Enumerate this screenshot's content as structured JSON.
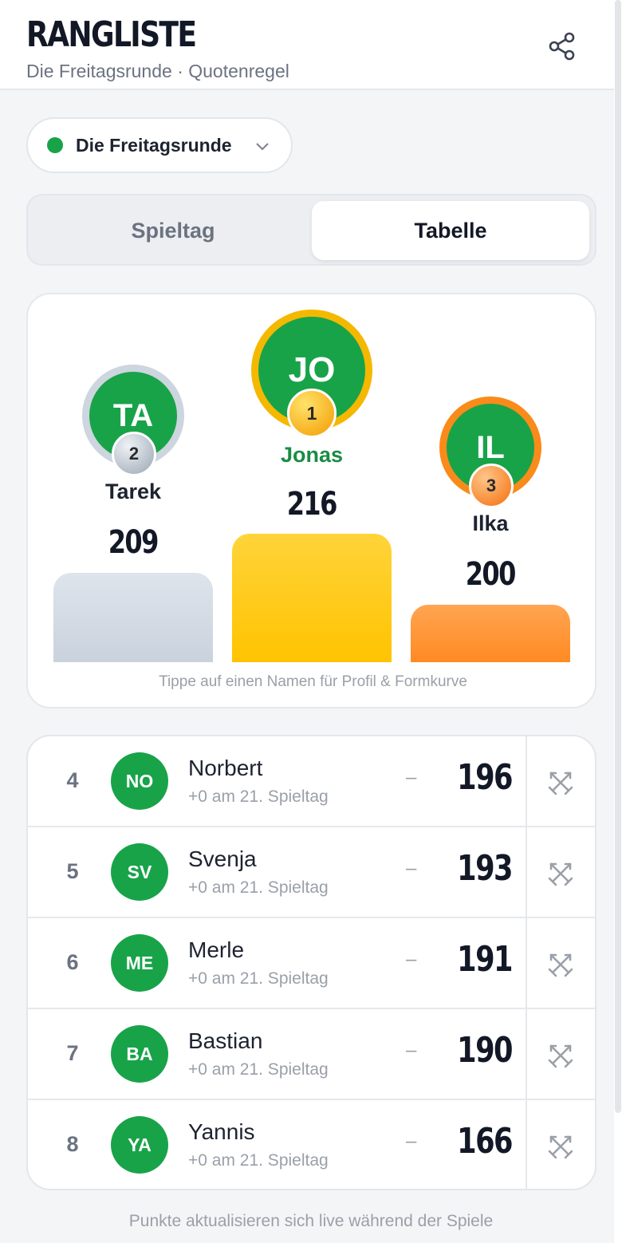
{
  "header": {
    "title": "RANGLISTE",
    "subtitle": "Die Freitagsrunde · Quotenregel",
    "share_icon": "share-icon"
  },
  "league_select": {
    "value": "Die Freitagsrunde",
    "status_color": "#18a349",
    "icon": "chevron-down-icon"
  },
  "tabs": [
    {
      "label": "Spieltag",
      "active": false
    },
    {
      "label": "Tabelle",
      "active": true
    }
  ],
  "podium": {
    "first": {
      "initials": "JO",
      "name": "Jonas",
      "rank": "1",
      "points": "216",
      "ring_color": "#f5b800"
    },
    "second": {
      "initials": "TA",
      "name": "Tarek",
      "rank": "2",
      "points": "209",
      "ring_color": "#cdd5df"
    },
    "third": {
      "initials": "IL",
      "name": "Ilka",
      "rank": "3",
      "points": "200",
      "ring_color": "#f98b1a"
    },
    "hint": "Tippe auf einen Namen für Profil & Formkurve"
  },
  "standings": [
    {
      "rank": "4",
      "initials": "NO",
      "name": "Norbert",
      "sub": "+0 am 21. Spieltag",
      "trend": "–",
      "points": "196",
      "action_icon": "swords-icon"
    },
    {
      "rank": "5",
      "initials": "SV",
      "name": "Svenja",
      "sub": "+0 am 21. Spieltag",
      "trend": "–",
      "points": "193",
      "action_icon": "swords-icon"
    },
    {
      "rank": "6",
      "initials": "ME",
      "name": "Merle",
      "sub": "+0 am 21. Spieltag",
      "trend": "–",
      "points": "191",
      "action_icon": "swords-icon"
    },
    {
      "rank": "7",
      "initials": "BA",
      "name": "Bastian",
      "sub": "+0 am 21. Spieltag",
      "trend": "–",
      "points": "190",
      "action_icon": "swords-icon"
    },
    {
      "rank": "8",
      "initials": "YA",
      "name": "Yannis",
      "sub": "+0 am 21. Spieltag",
      "trend": "–",
      "points": "166",
      "action_icon": "swords-icon"
    }
  ],
  "footer_note": "Punkte aktualisieren sich live während der Spiele",
  "colors": {
    "accent": "#18a349",
    "gold": "#f5b800",
    "silver": "#cdd5df",
    "bronze": "#f98b1a"
  }
}
